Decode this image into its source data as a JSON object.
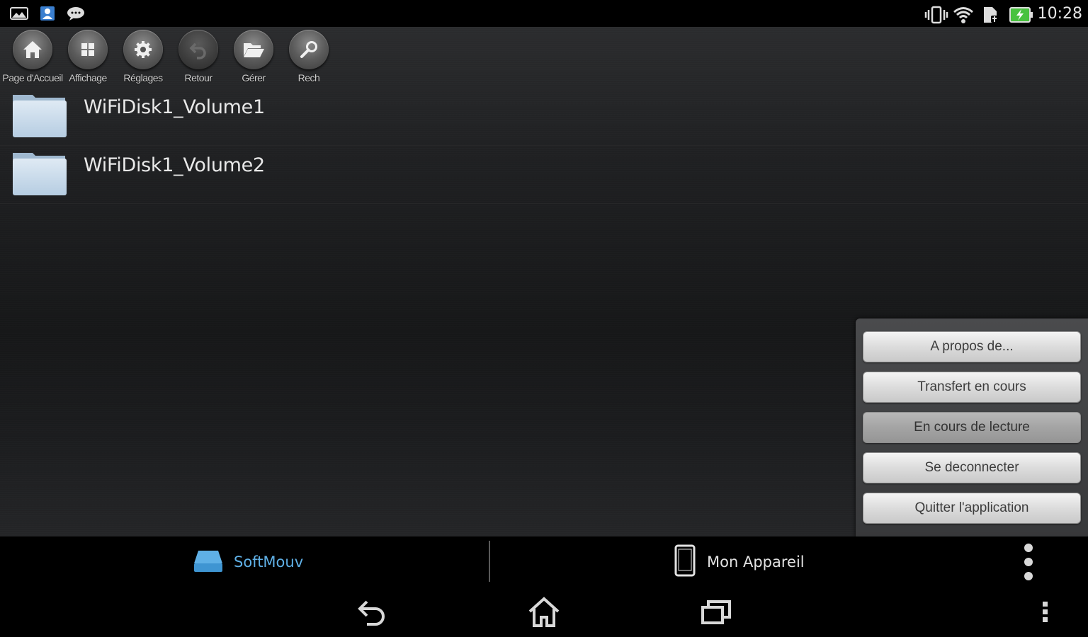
{
  "status": {
    "time": "10:28"
  },
  "toolbar": [
    {
      "label": "Page d'Accueil",
      "icon": "home-icon"
    },
    {
      "label": "Affichage",
      "icon": "grid-icon"
    },
    {
      "label": "Réglages",
      "icon": "gear-icon"
    },
    {
      "label": "Retour",
      "icon": "back-arrow-icon"
    },
    {
      "label": "Gérer",
      "icon": "folder-open-icon"
    },
    {
      "label": "Rech",
      "icon": "search-icon"
    }
  ],
  "files": [
    {
      "name": "WiFiDisk1_Volume1"
    },
    {
      "name": "WiFiDisk1_Volume2"
    }
  ],
  "menu": [
    {
      "label": "A propos de..."
    },
    {
      "label": "Transfert en cours"
    },
    {
      "label": "En cours de lecture"
    },
    {
      "label": "Se deconnecter"
    },
    {
      "label": "Quitter l'application"
    }
  ],
  "tabs": {
    "left_label": "SoftMouv",
    "right_label": "Mon Appareil"
  },
  "colors": {
    "accent": "#5fb0e6",
    "folder": "#c9dcec"
  }
}
